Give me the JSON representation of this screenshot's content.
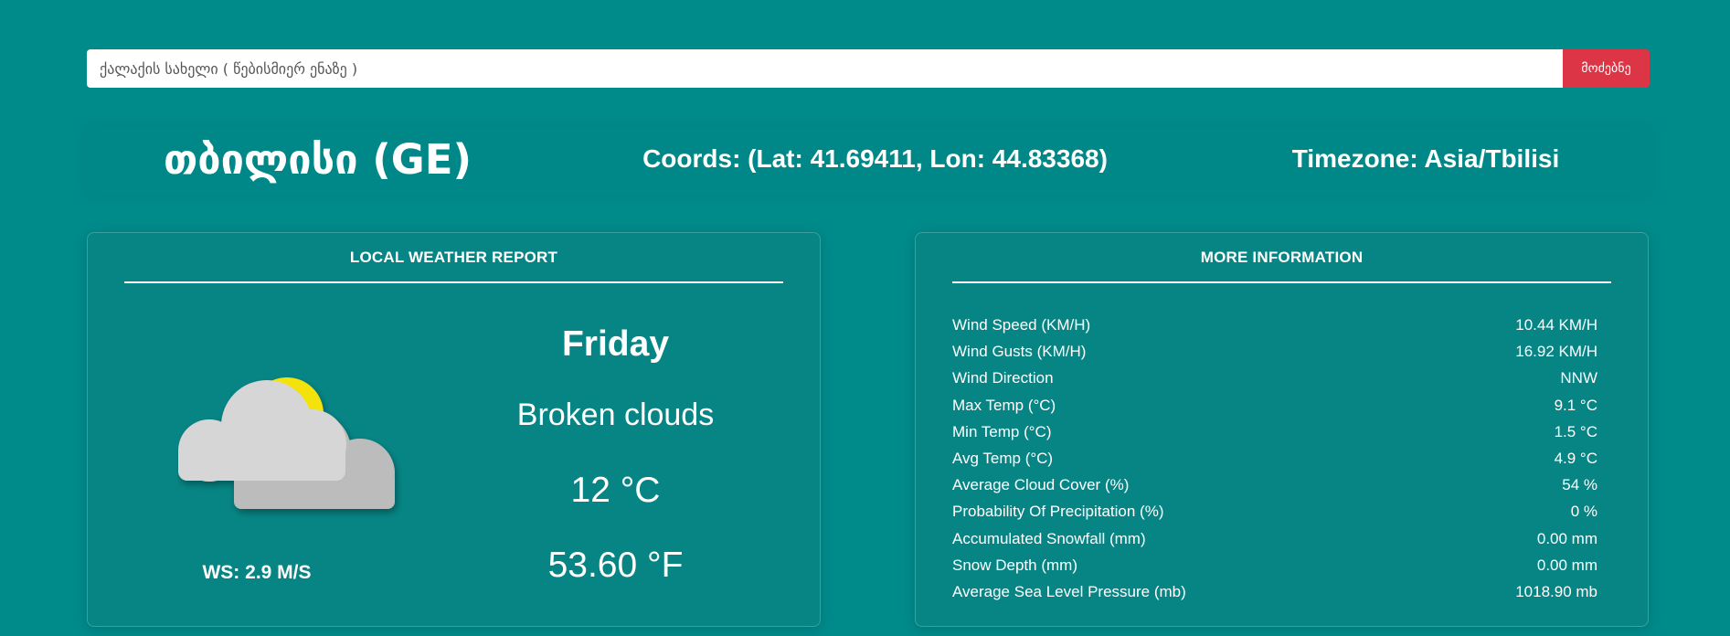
{
  "search": {
    "placeholder": "ქალაქის სახელი ( წებისმიერ ენაზე )",
    "value": "",
    "button_label": "მოძებნე"
  },
  "header": {
    "city": "თბილისი (GE)",
    "coords": "Coords: (Lat: 41.69411, Lon: 44.83368)",
    "timezone": "Timezone: Asia/Tbilisi"
  },
  "local_report": {
    "title": "LOCAL WEATHER REPORT",
    "icon": "broken-clouds-icon",
    "wind_speed": "WS: 2.9 M/S",
    "day": "Friday",
    "description": "Broken clouds",
    "temp_c": "12 °C",
    "temp_f": "53.60 °F"
  },
  "more_info": {
    "title": "MORE INFORMATION",
    "rows": [
      {
        "label": "Wind Speed (KM/H)",
        "value": "10.44 KM/H"
      },
      {
        "label": "Wind Gusts (KM/H)",
        "value": "16.92 KM/H"
      },
      {
        "label": "Wind Direction",
        "value": "NNW"
      },
      {
        "label": "Max Temp (°C)",
        "value": "9.1 °C"
      },
      {
        "label": "Min Temp (°C)",
        "value": "1.5 °C"
      },
      {
        "label": "Avg Temp (°C)",
        "value": "4.9 °C"
      },
      {
        "label": "Average Cloud Cover (%)",
        "value": "54 %"
      },
      {
        "label": "Probability Of Precipitation (%)",
        "value": "0 %"
      },
      {
        "label": "Accumulated Snowfall (mm)",
        "value": "0.00 mm"
      },
      {
        "label": "Snow Depth (mm)",
        "value": "0.00 mm"
      },
      {
        "label": "Average Sea Level Pressure (mb)",
        "value": "1018.90 mb"
      }
    ]
  },
  "colors": {
    "background": "#008b8b",
    "card": "#078585",
    "search_button": "#dc3545",
    "sun": "#f4e20c",
    "cloud_front": "#d6d6d6",
    "cloud_back": "#bcbcbc"
  }
}
